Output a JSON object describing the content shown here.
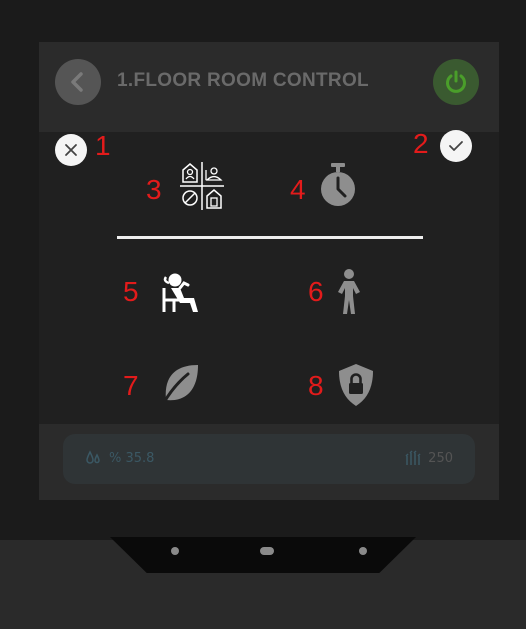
{
  "background_page": {
    "title": "1.FLOOR ROOM CONTROL",
    "status_bar": {
      "left_value": "% 35.8",
      "right_value": "250"
    }
  },
  "modal": {
    "annotations": {
      "close": "1",
      "confirm": "2",
      "room_modes": "3",
      "timer": "4",
      "comfort": "5",
      "standby": "6",
      "eco": "7",
      "protection": "8"
    },
    "icons": {
      "close": "close-icon",
      "confirm": "checkmark-icon",
      "room_modes": "room-grid-icon",
      "timer": "stopwatch-icon",
      "comfort": "relaxing-person-icon",
      "standby": "standing-person-icon",
      "eco": "leaf-icon",
      "protection": "shield-lock-icon"
    }
  },
  "colors": {
    "annotation": "#e31b1b",
    "icon_white": "#ffffff",
    "icon_grey": "#8e8e8e",
    "power_green": "#4a9e2a"
  }
}
